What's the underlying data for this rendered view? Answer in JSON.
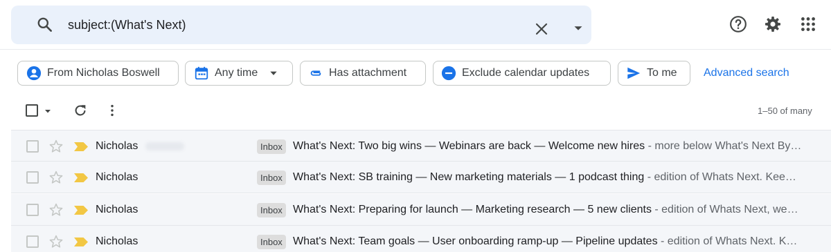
{
  "search": {
    "query": "subject:(What's Next)"
  },
  "chips": [
    {
      "label": "From Nicholas Boswell",
      "icon": "person-icon"
    },
    {
      "label": "Any time",
      "icon": "calendar-icon"
    },
    {
      "label": "Has attachment",
      "icon": "attachment-icon"
    },
    {
      "label": "Exclude calendar updates",
      "icon": "minus-circle-icon"
    },
    {
      "label": "To me",
      "icon": "send-icon"
    }
  ],
  "advanced_search_label": "Advanced search",
  "pager": "1–50 of many",
  "emails": [
    {
      "sender": "Nicholas",
      "label": "Inbox",
      "subject": "What's Next: Two big wins — Webinars are back — Welcome new hires",
      "snippet": " - more below What's Next By…"
    },
    {
      "sender": "Nicholas",
      "label": "Inbox",
      "subject": "What's Next: SB training — New marketing materials — 1 podcast thing",
      "snippet": " - edition of Whats Next. Kee…"
    },
    {
      "sender": "Nicholas",
      "label": "Inbox",
      "subject": "What's Next: Preparing for launch — Marketing research — 5 new clients",
      "snippet": " - edition of Whats Next, we…"
    },
    {
      "sender": "Nicholas",
      "label": "Inbox",
      "subject": "What's Next: Team goals — User onboarding ramp-up — Pipeline updates",
      "snippet": " - edition of Whats Next. K…"
    }
  ],
  "colors": {
    "search_bg": "#eaf1fb",
    "link": "#1a73e8",
    "chip_icon": "#1a73e8",
    "important_marker": "#f2c744",
    "row_bg": "#f4f6f9",
    "label_bg": "#dddddd"
  }
}
